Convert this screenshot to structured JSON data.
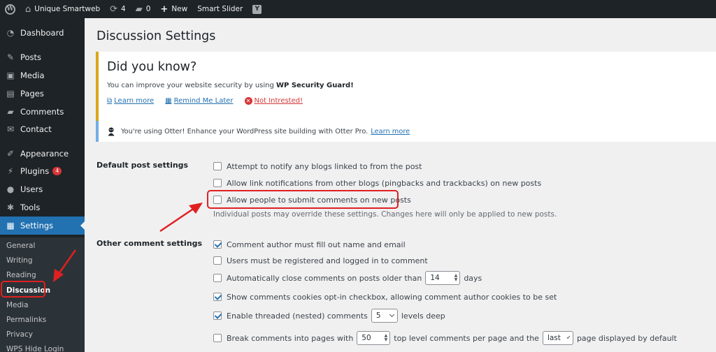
{
  "adminbar": {
    "site_name": "Unique Smartweb",
    "updates_count": "4",
    "comments_count": "0",
    "new_label": "New",
    "plugin_label": "Smart Slider"
  },
  "sidebar": {
    "items": [
      {
        "label": "Dashboard",
        "icon": "dashboard-icon"
      },
      {
        "label": "Posts",
        "icon": "pin-icon"
      },
      {
        "label": "Media",
        "icon": "media-icon"
      },
      {
        "label": "Pages",
        "icon": "pages-icon"
      },
      {
        "label": "Comments",
        "icon": "comment-icon"
      },
      {
        "label": "Contact",
        "icon": "mail-icon"
      },
      {
        "label": "Appearance",
        "icon": "brush-icon"
      },
      {
        "label": "Plugins",
        "icon": "plug-icon",
        "badge": "4"
      },
      {
        "label": "Users",
        "icon": "user-icon"
      },
      {
        "label": "Tools",
        "icon": "wrench-icon"
      },
      {
        "label": "Settings",
        "icon": "settings-icon"
      }
    ],
    "submenu": [
      "General",
      "Writing",
      "Reading",
      "Discussion",
      "Media",
      "Permalinks",
      "Privacy",
      "WPS Hide Login"
    ]
  },
  "page": {
    "title": "Discussion Settings"
  },
  "notice_dyk": {
    "heading": "Did you know?",
    "message_prefix": "You can improve your website security by using ",
    "message_bold": "WP Security Guard!",
    "learn_more": "Learn more",
    "remind_later": "Remind Me Later",
    "not_interested": "Not Intrested!"
  },
  "notice_otter": {
    "message": "You're using Otter! Enhance your WordPress site building with Otter Pro.",
    "link": "Learn more"
  },
  "default_post": {
    "label": "Default post settings",
    "options": [
      {
        "label": "Attempt to notify any blogs linked to from the post",
        "checked": false
      },
      {
        "label": "Allow link notifications from other blogs (pingbacks and trackbacks) on new posts",
        "checked": false
      },
      {
        "label": "Allow people to submit comments on new posts",
        "checked": false
      }
    ],
    "description": "Individual posts may override these settings. Changes here will only be applied to new posts."
  },
  "other_comment": {
    "label": "Other comment settings",
    "author_fill": "Comment author must fill out name and email",
    "registered": "Users must be registered and logged in to comment",
    "auto_close_prefix": "Automatically close comments on posts older than",
    "auto_close_value": "14",
    "auto_close_suffix": "days",
    "cookies": "Show comments cookies opt-in checkbox, allowing comment author cookies to be set",
    "threaded_prefix": "Enable threaded (nested) comments",
    "threaded_value": "5",
    "threaded_suffix": "levels deep",
    "break_prefix": "Break comments into pages with",
    "break_value": "50",
    "break_middle": "top level comments per page and the",
    "break_select": "last",
    "break_suffix": "page displayed by default"
  },
  "colors": {
    "accent": "#2271b1",
    "sidebar_bg": "#1d2327",
    "annotation": "#e02020"
  }
}
